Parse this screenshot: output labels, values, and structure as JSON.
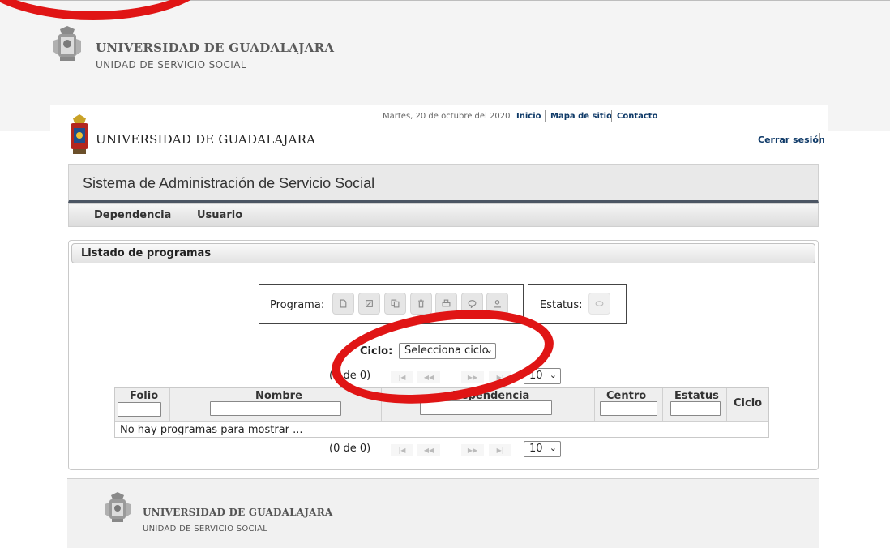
{
  "outer_header": {
    "title": "UNIVERSIDAD DE GUADALAJARA",
    "subtitle": "UNIDAD DE SERVICIO SOCIAL"
  },
  "inner_header": {
    "date": "Martes, 20 de octubre del 2020",
    "links": [
      "Inicio",
      "Mapa de sitio",
      "Contacto"
    ],
    "logo_title": "UNIVERSIDAD DE GUADALAJARA",
    "logout": "Cerrar sesión"
  },
  "system_title": "Sistema de Administración de Servicio Social",
  "menu": [
    "Dependencia",
    "Usuario"
  ],
  "panel": {
    "title": "Listado de programas",
    "programa_label": "Programa:",
    "programa_icons": [
      "new-icon",
      "edit-icon",
      "copy-icon",
      "delete-icon",
      "print-icon",
      "comment-icon",
      "user-icon"
    ],
    "estatus_label": "Estatus:",
    "estatus_icon": "status-icon",
    "ciclo_label": "Ciclo:",
    "ciclo_value": "Selecciona ciclo"
  },
  "pager": {
    "count_text": "(0 de 0)",
    "page_size": "10"
  },
  "table": {
    "columns": [
      "Folio",
      "Nombre",
      "Dependencia",
      "Centro",
      "Estatus",
      "Ciclo"
    ],
    "empty_message": "No hay programas para mostrar ..."
  },
  "footer": {
    "title": "UNIVERSIDAD DE GUADALAJARA",
    "subtitle": "UNIDAD DE SERVICIO SOCIAL"
  },
  "colors": {
    "annotation": "#e01515",
    "link": "#0f3a68",
    "bar_border": "#4b5563"
  }
}
